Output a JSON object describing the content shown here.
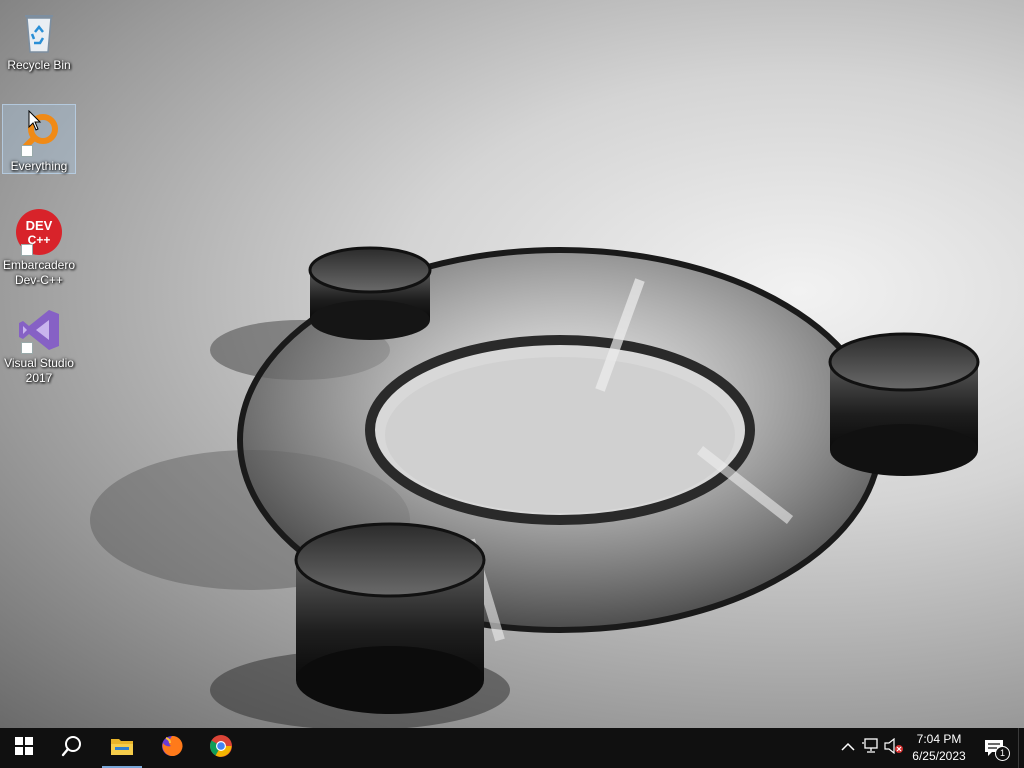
{
  "desktop": {
    "icons": [
      {
        "label": "Recycle Bin",
        "icon": "recycle-bin-icon",
        "shortcut": false,
        "selected": false
      },
      {
        "label": "Everything",
        "icon": "everything-search-icon",
        "shortcut": true,
        "selected": true
      },
      {
        "label": "Embarcadero\nDev-C++",
        "icon": "devcpp-icon",
        "shortcut": true,
        "selected": false,
        "badge_line1": "DEV",
        "badge_line2": "C++"
      },
      {
        "label": "Visual Studio\n2017",
        "icon": "visual-studio-icon",
        "shortcut": true,
        "selected": false
      }
    ]
  },
  "taskbar": {
    "buttons": [
      {
        "name": "start",
        "icon": "windows-logo-icon"
      },
      {
        "name": "search",
        "icon": "search-icon"
      },
      {
        "name": "file-explorer",
        "icon": "folder-icon",
        "active": true
      },
      {
        "name": "firefox",
        "icon": "firefox-icon"
      },
      {
        "name": "chrome",
        "icon": "chrome-icon"
      }
    ],
    "tray": {
      "icons": [
        "chevron-up-icon",
        "network-icon",
        "volume-muted-icon"
      ],
      "time": "7:04 PM",
      "date": "6/25/2023",
      "notification_count": "1"
    }
  },
  "colors": {
    "taskbar": "#101010",
    "accent": "#7aa7d8",
    "devcpp_red": "#d8232a",
    "vs_purple": "#8661c5",
    "everything_orange": "#f08a16"
  }
}
